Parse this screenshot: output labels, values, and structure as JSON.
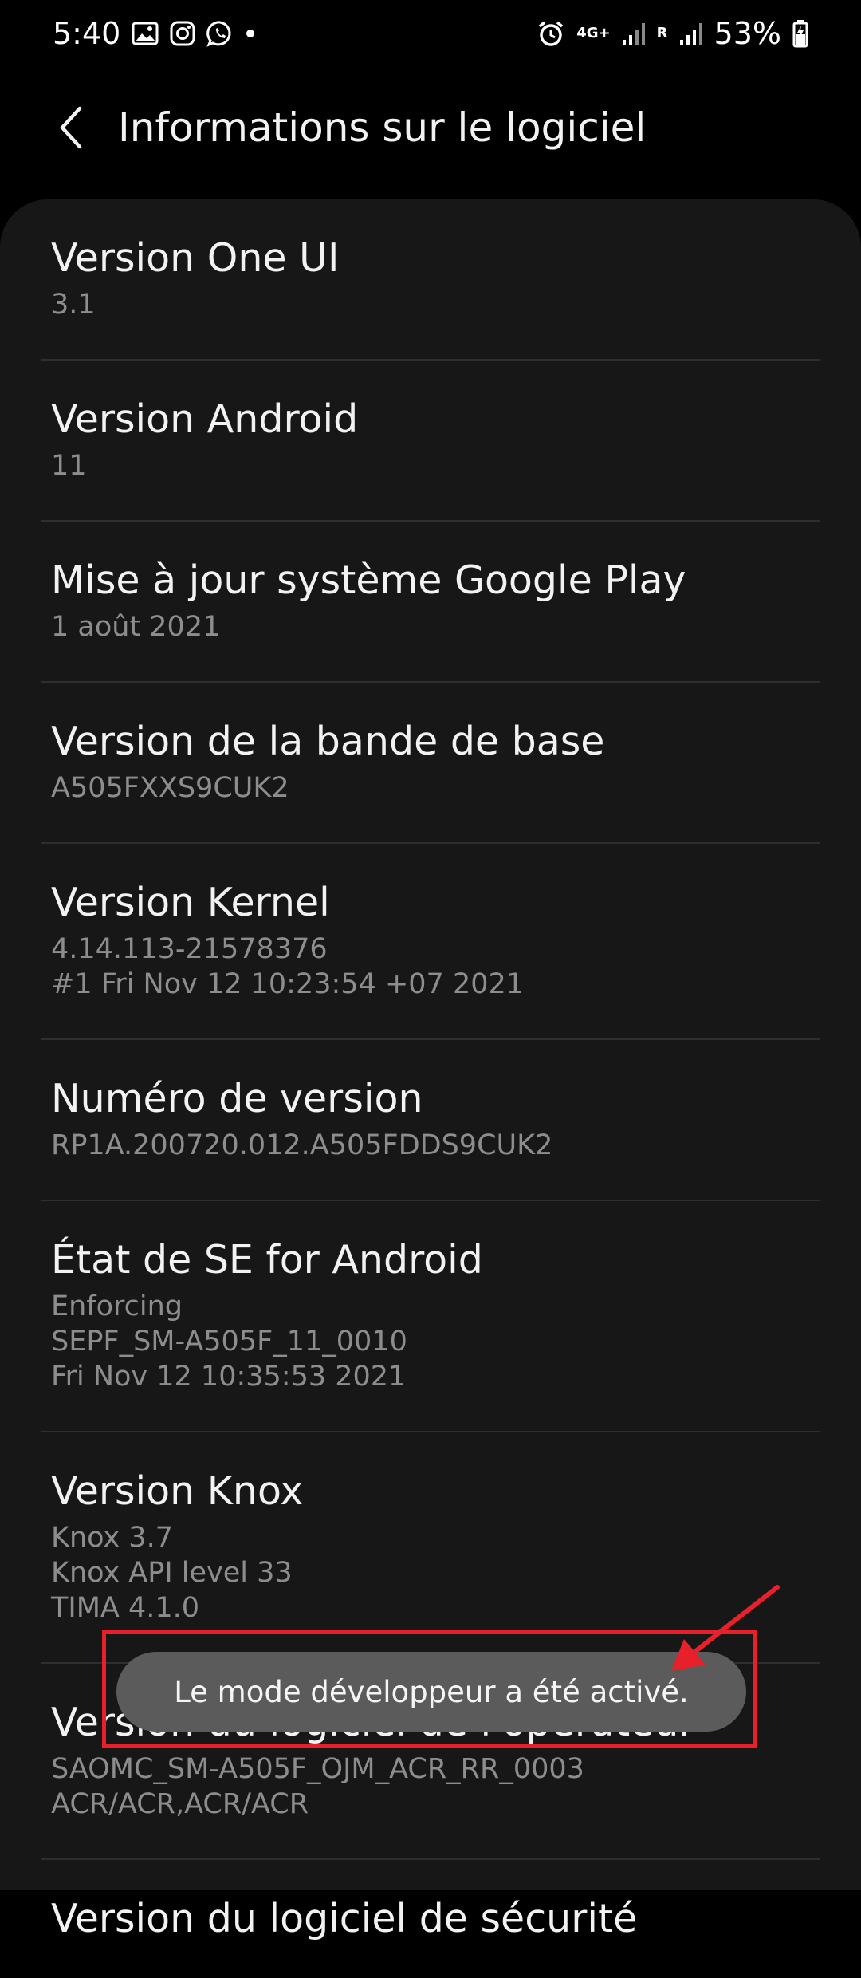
{
  "status_bar": {
    "time": "5:40",
    "network": "4G+",
    "sim_label": "R",
    "battery": "53%",
    "accent": "#ffffff"
  },
  "header": {
    "title": "Informations sur le logiciel",
    "back_icon": "chevron-left-icon"
  },
  "items": [
    {
      "title": "Version One UI",
      "lines": [
        "3.1"
      ]
    },
    {
      "title": "Version Android",
      "lines": [
        "11"
      ]
    },
    {
      "title": "Mise à jour système Google Play",
      "lines": [
        "1 août 2021"
      ]
    },
    {
      "title": "Version de la bande de base",
      "lines": [
        "A505FXXS9CUK2"
      ]
    },
    {
      "title": "Version Kernel",
      "lines": [
        "4.14.113-21578376",
        "#1 Fri Nov 12 10:23:54 +07 2021"
      ]
    },
    {
      "title": "Numéro de version",
      "lines": [
        "RP1A.200720.012.A505FDDS9CUK2"
      ]
    },
    {
      "title": "État de SE for Android",
      "lines": [
        "Enforcing",
        "SEPF_SM-A505F_11_0010",
        "Fri Nov 12 10:35:53 2021"
      ]
    },
    {
      "title": "Version Knox",
      "lines": [
        "Knox 3.7",
        "Knox API level 33",
        "TIMA 4.1.0"
      ]
    },
    {
      "title": "Version du logiciel de l'opérateur",
      "lines": [
        "SAOMC_SM-A505F_OJM_ACR_RR_0003",
        "ACR/ACR,ACR/ACR"
      ]
    },
    {
      "title": "Version du logiciel de sécurité",
      "lines": []
    }
  ],
  "toast": {
    "message": "Le mode développeur a été activé."
  },
  "colors": {
    "background": "#000000",
    "card": "#171717",
    "divider": "#2e2e2e",
    "subtitle": "#8d8d8d",
    "toast": "#5b5b5b",
    "annotation": "#e8202a"
  }
}
